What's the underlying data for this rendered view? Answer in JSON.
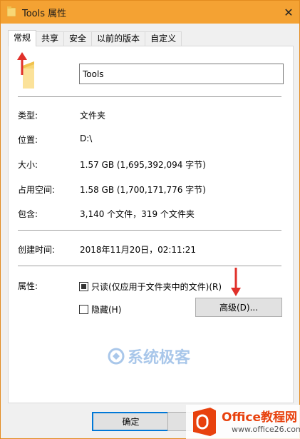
{
  "window": {
    "title": "Tools 属性",
    "close_glyph": "✕"
  },
  "tabs": [
    {
      "label": "常规",
      "active": true
    },
    {
      "label": "共享"
    },
    {
      "label": "安全"
    },
    {
      "label": "以前的版本"
    },
    {
      "label": "自定义"
    }
  ],
  "general": {
    "name_value": "Tools",
    "type_label": "类型:",
    "type_value": "文件夹",
    "location_label": "位置:",
    "location_value": "D:\\",
    "size_label": "大小:",
    "size_value": "1.57 GB (1,695,392,094 字节)",
    "disk_size_label": "占用空间:",
    "disk_size_value": "1.58 GB (1,700,171,776 字节)",
    "contains_label": "包含:",
    "contains_value": "3,140 个文件，319 个文件夹",
    "created_label": "创建时间:",
    "created_value": "2018年11月20日，02:11:21",
    "attributes_label": "属性:",
    "readonly_label": "只读(仅应用于文件夹中的文件)(R)",
    "hidden_label": "隐藏(H)",
    "advanced_button": "高级(D)..."
  },
  "footer": {
    "ok_button": "确定"
  },
  "watermark": {
    "text": "系统极客"
  },
  "corner_logo": {
    "name": "Office教程网",
    "url": "www.office26.com"
  },
  "colors": {
    "titlebar": "#f4a233",
    "arrow": "#e0302a",
    "folder": "#f8d775"
  }
}
